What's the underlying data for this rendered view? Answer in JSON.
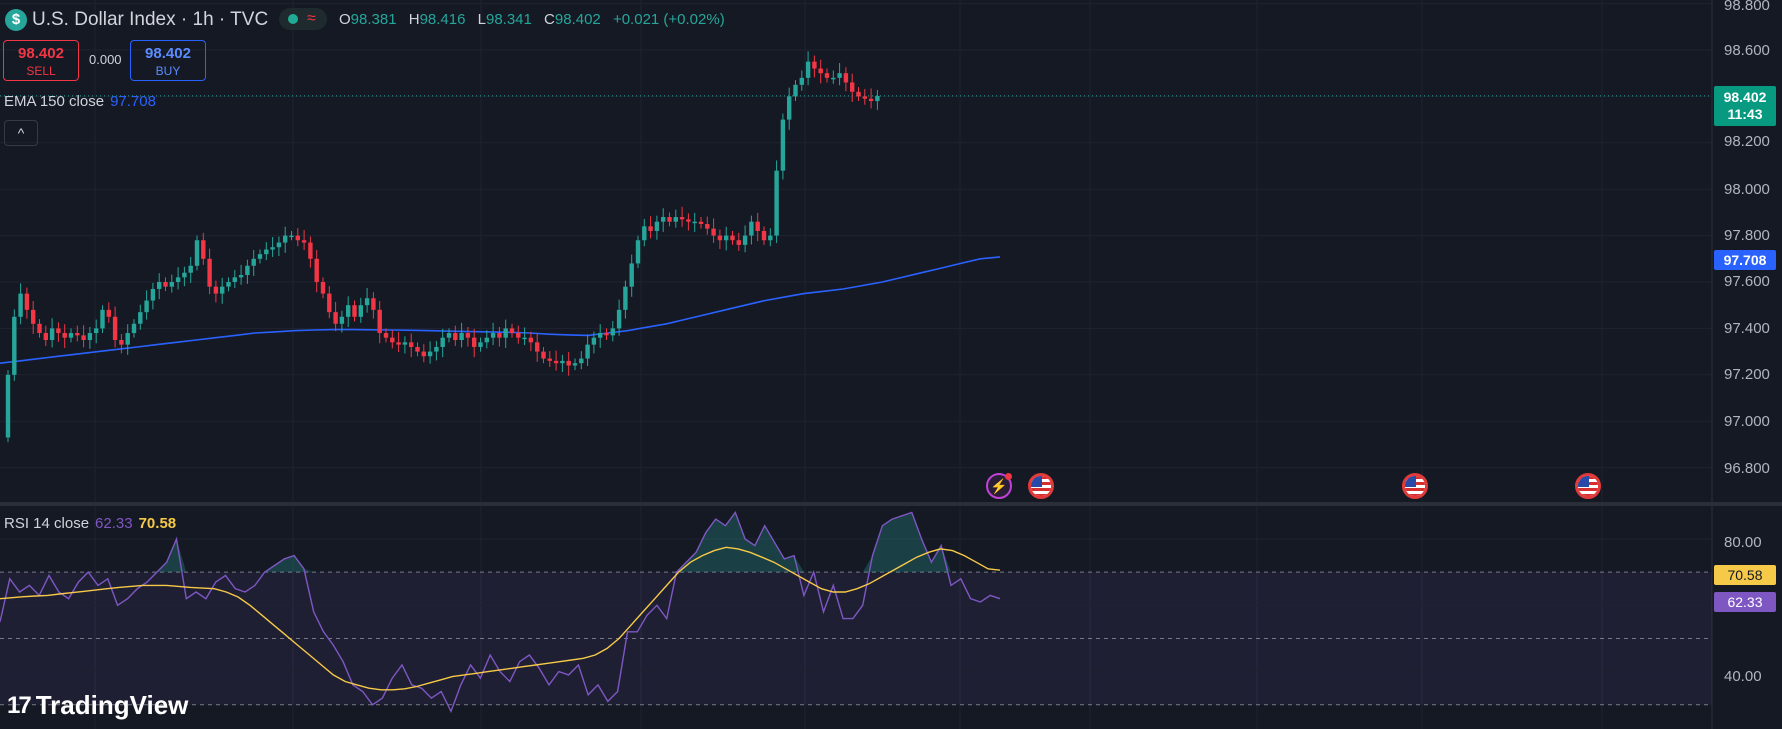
{
  "symbol": {
    "title": "U.S. Dollar Index · 1h · TVC",
    "icon": "dollar-icon",
    "ohlc": {
      "o_label": "O",
      "o": "98.381",
      "h_label": "H",
      "h": "98.416",
      "l_label": "L",
      "l": "98.341",
      "c_label": "C",
      "c": "98.402",
      "change": "+0.021 (+0.02%)"
    }
  },
  "trade": {
    "sell_price": "98.402",
    "sell_label": "SELL",
    "spread": "0.000",
    "buy_price": "98.402",
    "buy_label": "BUY"
  },
  "ema_legend": {
    "label": "EMA 150 close",
    "value": "97.708"
  },
  "rsi_legend": {
    "label": "RSI 14 close",
    "value": "62.33",
    "signal": "70.58"
  },
  "price_axis": {
    "ticks": [
      "98.800",
      "98.600",
      "98.400",
      "98.200",
      "98.000",
      "97.800",
      "97.600",
      "97.400",
      "97.200",
      "97.000",
      "96.800"
    ],
    "last_price": "98.402",
    "countdown": "11:43",
    "ema_tag": "97.708"
  },
  "rsi_axis": {
    "ticks": [
      "80.00",
      "60.00",
      "40.00"
    ],
    "signal_tag": "70.58",
    "rsi_tag": "62.33"
  },
  "events": [
    {
      "icon": "lightning-icon"
    },
    {
      "icon": "us-flag-icon"
    },
    {
      "icon": "us-flag-icon"
    },
    {
      "icon": "us-flag-icon"
    }
  ],
  "brand": {
    "name": "TradingView",
    "logo": "tradingview-logo-icon"
  },
  "colors": {
    "background": "#151924",
    "up": "#26a69a",
    "down": "#f23645",
    "ema": "#2962ff",
    "rsi": "#7e57c2",
    "rsi_signal": "#f7c948"
  },
  "chart_data": [
    {
      "type": "candlestick",
      "title": "",
      "ylim": [
        96.7,
        98.8
      ],
      "open": [
        96.93,
        97.2,
        97.45,
        97.55,
        97.48,
        97.42,
        97.38,
        97.35,
        97.4,
        97.38,
        97.36,
        97.38,
        97.37,
        97.35,
        97.38,
        97.4,
        97.48,
        97.45,
        97.35,
        97.33,
        97.38,
        97.42,
        97.47,
        97.52,
        97.57,
        97.6,
        97.58,
        97.6,
        97.62,
        97.64,
        97.67,
        97.78,
        97.7,
        97.58,
        97.55,
        97.58,
        97.6,
        97.62,
        97.63,
        97.67,
        97.7,
        97.72,
        97.74,
        97.75,
        97.77,
        97.8,
        97.8,
        97.78,
        97.77,
        97.7,
        97.6,
        97.55,
        97.47,
        97.42,
        97.45,
        97.5,
        97.45,
        97.5,
        97.53,
        97.48,
        97.38,
        97.36,
        97.34,
        97.33,
        97.34,
        97.32,
        97.3,
        97.28,
        97.3,
        97.32,
        97.36,
        97.38,
        97.35,
        97.38,
        97.36,
        97.32,
        97.34,
        97.36,
        97.38,
        97.36,
        97.4,
        97.38,
        97.36,
        97.36,
        97.34,
        97.3,
        97.27,
        97.26,
        97.25,
        97.26,
        97.24,
        97.25,
        97.27,
        97.33,
        97.36,
        97.38,
        97.37,
        97.4,
        97.48,
        97.58,
        97.68,
        97.78,
        97.84,
        97.82,
        97.86,
        97.88,
        97.86,
        97.88,
        97.87,
        97.86,
        97.86,
        97.85,
        97.83,
        97.8,
        97.78,
        97.8,
        97.78,
        97.76,
        97.8,
        97.86,
        97.82,
        97.78,
        97.8,
        98.08,
        98.3,
        98.4,
        98.45,
        98.48,
        98.55,
        98.52,
        98.5,
        98.48,
        98.48,
        98.5,
        98.46,
        98.42,
        98.4,
        98.39,
        98.38
      ],
      "close": [
        97.2,
        97.45,
        97.55,
        97.48,
        97.42,
        97.38,
        97.35,
        97.4,
        97.38,
        97.36,
        97.38,
        97.37,
        97.35,
        97.38,
        97.4,
        97.48,
        97.45,
        97.35,
        97.33,
        97.38,
        97.42,
        97.47,
        97.52,
        97.57,
        97.6,
        97.58,
        97.6,
        97.62,
        97.64,
        97.67,
        97.78,
        97.7,
        97.58,
        97.55,
        97.58,
        97.6,
        97.62,
        97.63,
        97.67,
        97.7,
        97.72,
        97.74,
        97.75,
        97.77,
        97.8,
        97.8,
        97.78,
        97.77,
        97.7,
        97.6,
        97.55,
        97.47,
        97.42,
        97.45,
        97.5,
        97.45,
        97.5,
        97.53,
        97.48,
        97.38,
        97.36,
        97.34,
        97.33,
        97.34,
        97.32,
        97.3,
        97.28,
        97.3,
        97.32,
        97.36,
        97.38,
        97.35,
        97.38,
        97.36,
        97.32,
        97.34,
        97.36,
        97.38,
        97.36,
        97.4,
        97.38,
        97.36,
        97.36,
        97.34,
        97.3,
        97.27,
        97.26,
        97.25,
        97.26,
        97.24,
        97.25,
        97.27,
        97.33,
        97.36,
        97.38,
        97.37,
        97.4,
        97.48,
        97.58,
        97.68,
        97.78,
        97.84,
        97.82,
        97.86,
        97.88,
        97.86,
        97.88,
        97.87,
        97.86,
        97.86,
        97.85,
        97.83,
        97.8,
        97.78,
        97.8,
        97.78,
        97.76,
        97.8,
        97.86,
        97.82,
        97.78,
        97.8,
        98.08,
        98.3,
        98.4,
        98.45,
        98.48,
        98.55,
        98.52,
        98.5,
        98.48,
        98.48,
        98.5,
        98.46,
        98.42,
        98.4,
        98.39,
        98.38,
        98.402
      ],
      "ema": [
        97.25,
        97.26,
        97.27,
        97.28,
        97.29,
        97.3,
        97.31,
        97.32,
        97.33,
        97.34,
        97.35,
        97.36,
        97.37,
        97.38,
        97.385,
        97.39,
        97.393,
        97.395,
        97.395,
        97.394,
        97.393,
        97.392,
        97.39,
        97.388,
        97.386,
        97.385,
        97.383,
        97.38,
        97.375,
        97.372,
        97.37,
        97.38,
        97.39,
        97.405,
        97.42,
        97.44,
        97.46,
        97.48,
        97.5,
        97.52,
        97.535,
        97.55,
        97.56,
        97.57,
        97.585,
        97.6,
        97.62,
        97.64,
        97.66,
        97.68,
        97.7,
        97.708
      ]
    },
    {
      "type": "line",
      "title": "",
      "ylim": [
        30,
        90
      ],
      "series": [
        {
          "name": "RSI 14 close",
          "values": [
            55,
            68,
            64,
            66,
            63,
            69,
            64,
            62,
            67,
            70,
            66,
            68,
            60,
            62,
            65,
            67,
            70,
            73,
            80,
            62,
            64,
            62,
            67,
            69,
            65,
            64,
            66,
            70,
            72,
            74,
            75,
            71,
            58,
            52,
            48,
            43,
            36,
            34,
            30,
            32,
            38,
            42,
            36,
            35,
            32,
            34,
            28,
            36,
            42,
            38,
            45,
            40,
            37,
            43,
            45,
            41,
            36,
            40,
            39,
            42,
            33,
            36,
            31,
            34,
            52,
            52,
            57,
            60,
            56,
            70,
            73,
            76,
            82,
            86,
            84,
            88,
            80,
            78,
            84,
            79,
            74,
            75,
            63,
            70,
            58,
            66,
            56,
            56,
            60,
            75,
            84,
            86,
            87,
            88,
            80,
            73,
            78,
            66,
            68,
            62,
            61,
            63,
            62
          ]
        },
        {
          "name": "",
          "values": [
            62,
            62.3,
            62.6,
            62.8,
            63,
            63.4,
            63.8,
            64.2,
            64.6,
            65,
            65.4,
            65.7,
            66,
            66,
            66,
            65.7,
            65.4,
            65.2,
            65,
            64,
            62.5,
            60,
            57,
            54,
            51,
            48,
            45,
            42,
            39,
            37,
            36,
            35,
            34.5,
            34.5,
            34.8,
            35.5,
            36.5,
            37.5,
            38.5,
            39,
            39.5,
            40,
            40.5,
            41,
            41.5,
            42,
            42.5,
            43,
            43.5,
            44,
            45,
            47,
            50,
            54,
            58,
            62,
            66,
            70,
            73,
            75,
            76.5,
            77.5,
            77,
            76,
            74.5,
            73,
            71,
            69,
            67,
            65,
            64,
            64,
            65,
            66.5,
            68.5,
            70.5,
            72.5,
            74.5,
            76,
            77,
            76.5,
            75,
            73,
            71,
            70.58
          ]
        }
      ]
    }
  ]
}
